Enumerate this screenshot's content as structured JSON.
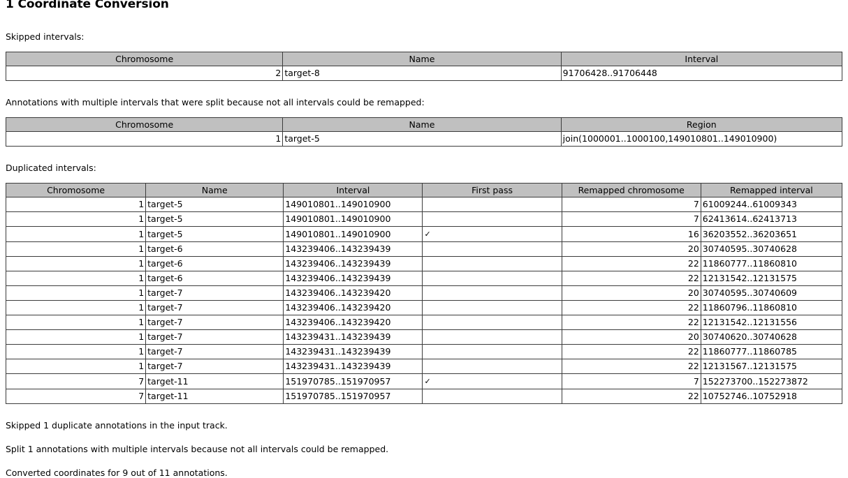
{
  "title": "1 Coordinate Conversion",
  "labels": {
    "skipped_intervals": "Skipped intervals:",
    "split_annotations": "Annotations with multiple intervals that were split because not all intervals could be remapped:",
    "duplicated_intervals": "Duplicated intervals:"
  },
  "skipped_table": {
    "headers": [
      "Chromosome",
      "Name",
      "Interval"
    ],
    "rows": [
      {
        "chromosome": "2",
        "name": "target-8",
        "interval": "91706428..91706448"
      }
    ]
  },
  "split_table": {
    "headers": [
      "Chromosome",
      "Name",
      "Region"
    ],
    "rows": [
      {
        "chromosome": "1",
        "name": "target-5",
        "region": "join(1000001..1000100,149010801..149010900)"
      }
    ]
  },
  "duplicated_table": {
    "headers": [
      "Chromosome",
      "Name",
      "Interval",
      "First pass",
      "Remapped chromosome",
      "Remapped interval"
    ],
    "check_glyph": "✓",
    "rows": [
      {
        "chromosome": "1",
        "name": "target-5",
        "interval": "149010801..149010900",
        "first_pass": "",
        "remapped_chromosome": "7",
        "remapped_interval": "61009244..61009343"
      },
      {
        "chromosome": "1",
        "name": "target-5",
        "interval": "149010801..149010900",
        "first_pass": "",
        "remapped_chromosome": "7",
        "remapped_interval": "62413614..62413713"
      },
      {
        "chromosome": "1",
        "name": "target-5",
        "interval": "149010801..149010900",
        "first_pass": "✓",
        "remapped_chromosome": "16",
        "remapped_interval": "36203552..36203651"
      },
      {
        "chromosome": "1",
        "name": "target-6",
        "interval": "143239406..143239439",
        "first_pass": "",
        "remapped_chromosome": "20",
        "remapped_interval": "30740595..30740628"
      },
      {
        "chromosome": "1",
        "name": "target-6",
        "interval": "143239406..143239439",
        "first_pass": "",
        "remapped_chromosome": "22",
        "remapped_interval": "11860777..11860810"
      },
      {
        "chromosome": "1",
        "name": "target-6",
        "interval": "143239406..143239439",
        "first_pass": "",
        "remapped_chromosome": "22",
        "remapped_interval": "12131542..12131575"
      },
      {
        "chromosome": "1",
        "name": "target-7",
        "interval": "143239406..143239420",
        "first_pass": "",
        "remapped_chromosome": "20",
        "remapped_interval": "30740595..30740609"
      },
      {
        "chromosome": "1",
        "name": "target-7",
        "interval": "143239406..143239420",
        "first_pass": "",
        "remapped_chromosome": "22",
        "remapped_interval": "11860796..11860810"
      },
      {
        "chromosome": "1",
        "name": "target-7",
        "interval": "143239406..143239420",
        "first_pass": "",
        "remapped_chromosome": "22",
        "remapped_interval": "12131542..12131556"
      },
      {
        "chromosome": "1",
        "name": "target-7",
        "interval": "143239431..143239439",
        "first_pass": "",
        "remapped_chromosome": "20",
        "remapped_interval": "30740620..30740628"
      },
      {
        "chromosome": "1",
        "name": "target-7",
        "interval": "143239431..143239439",
        "first_pass": "",
        "remapped_chromosome": "22",
        "remapped_interval": "11860777..11860785"
      },
      {
        "chromosome": "1",
        "name": "target-7",
        "interval": "143239431..143239439",
        "first_pass": "",
        "remapped_chromosome": "22",
        "remapped_interval": "12131567..12131575"
      },
      {
        "chromosome": "7",
        "name": "target-11",
        "interval": "151970785..151970957",
        "first_pass": "✓",
        "remapped_chromosome": "7",
        "remapped_interval": "152273700..152273872"
      },
      {
        "chromosome": "7",
        "name": "target-11",
        "interval": "151970785..151970957",
        "first_pass": "",
        "remapped_chromosome": "22",
        "remapped_interval": "10752746..10752918"
      }
    ]
  },
  "summary": {
    "line1": "Skipped 1 duplicate annotations in the input track.",
    "line2": "Split 1 annotations with multiple intervals because not all intervals could be remapped.",
    "line3": "Converted coordinates for 9 out of 11 annotations."
  },
  "colors": {
    "header_background": "#c0c0c0",
    "border": "#3c3c3c",
    "outer_border": "#808080",
    "text": "#000000",
    "page_background": "#ffffff"
  }
}
